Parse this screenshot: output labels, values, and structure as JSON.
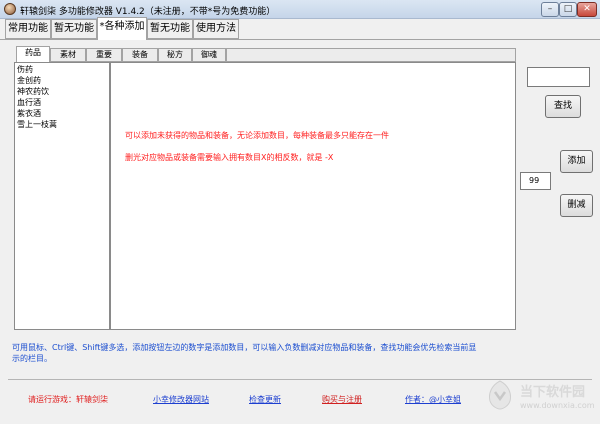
{
  "window": {
    "title": "轩辕剑柒 多功能修改器 V1.4.2（未注册，不带*号为免费功能）",
    "controls": {
      "minimize": "–",
      "maximize": "□",
      "close": "✕"
    }
  },
  "top_tabs": [
    {
      "label": "常用功能",
      "active": false
    },
    {
      "label": "暂无功能",
      "active": false
    },
    {
      "label": "*各种添加",
      "active": true
    },
    {
      "label": "暂无功能",
      "active": false
    },
    {
      "label": "使用方法",
      "active": false
    }
  ],
  "inner_tabs": [
    {
      "label": "药品",
      "active": true
    },
    {
      "label": "素材",
      "active": false
    },
    {
      "label": "重要",
      "active": false
    },
    {
      "label": "装备",
      "active": false
    },
    {
      "label": "秘方",
      "active": false
    },
    {
      "label": "御魂",
      "active": false
    }
  ],
  "item_list": [
    "伤药",
    "金创药",
    "神农药饮",
    "血行酒",
    "紫衣酒",
    "雪上一枝蒿"
  ],
  "panel_text": {
    "line1": "可以添加未获得的物品和装备，无论添加数目，每种装备最多只能存在一件",
    "line2": "删光对应物品或装备需要输入拥有数目X的相反数，就是 -X"
  },
  "controls": {
    "search_value": "",
    "search_button": "查找",
    "add_button": "添加",
    "quantity": "99",
    "remove_button": "删减"
  },
  "hint": {
    "line1": "可用鼠标、Ctrl键、Shift键多选，添加按钮左边的数字是添加数目，可以输入负数删减对应物品和装备，查找功能会优先检索当前显",
    "line2": "示的栏目。"
  },
  "bottom": {
    "status": "请运行游戏：轩辕剑柒",
    "links": [
      "小幸修改器网站",
      "检查更新",
      "购买与注册",
      "作者：@小幸姐"
    ]
  },
  "watermark": {
    "text": "当下软件园",
    "url": "www.downxia.com"
  },
  "colors": {
    "hint": "#1d4fd0",
    "warning": "#ff2020",
    "link": "#1d3fd0"
  }
}
